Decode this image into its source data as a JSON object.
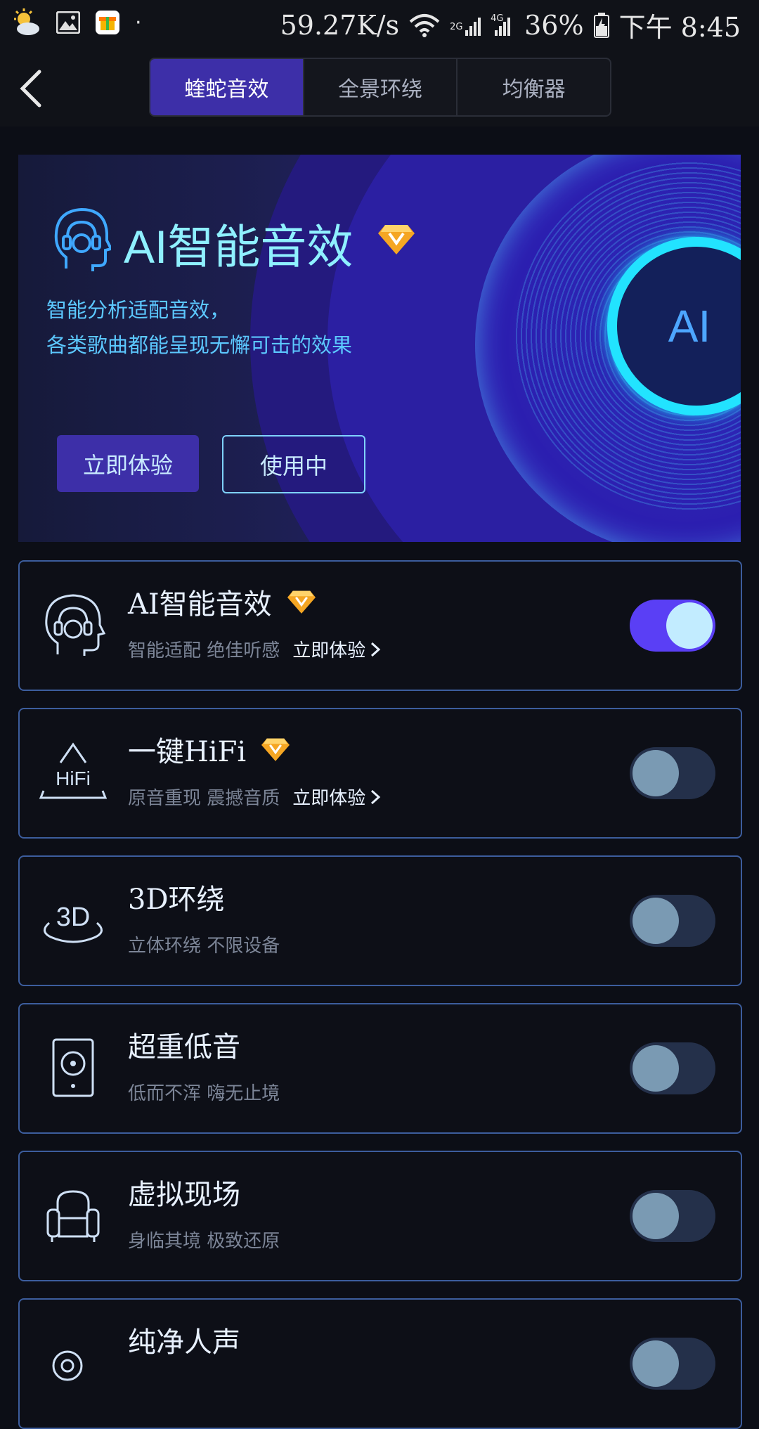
{
  "status_bar": {
    "net_speed": "59.27K/s",
    "net_type_2g": "2G",
    "net_type_4g": "4G",
    "battery": "36%",
    "time": "下午 8:45",
    "dot": "·"
  },
  "header": {
    "tabs": [
      {
        "label": "蝰蛇音效",
        "active": true
      },
      {
        "label": "全景环绕",
        "active": false
      },
      {
        "label": "均衡器",
        "active": false
      }
    ]
  },
  "banner": {
    "title": "AI智能音效",
    "desc_line1": "智能分析适配音效，",
    "desc_line2": "各类歌曲都能呈现无懈可击的效果",
    "try_button": "立即体验",
    "using_button": "使用中",
    "circle_text": "AI"
  },
  "effects": [
    {
      "title": "AI智能音效",
      "vip": true,
      "sub": "智能适配 绝佳听感",
      "link": "立即体验",
      "enabled": true,
      "icon": "head-icon"
    },
    {
      "title": "一键HiFi",
      "vip": true,
      "sub": "原音重现 震撼音质",
      "link": "立即体验",
      "enabled": false,
      "icon": "hifi-icon"
    },
    {
      "title": "3D环绕",
      "vip": false,
      "sub": "立体环绕 不限设备",
      "link": "",
      "enabled": false,
      "icon": "3d-icon"
    },
    {
      "title": "超重低音",
      "vip": false,
      "sub": "低而不浑 嗨无止境",
      "link": "",
      "enabled": false,
      "icon": "speaker-icon"
    },
    {
      "title": "虚拟现场",
      "vip": false,
      "sub": "身临其境 极致还原",
      "link": "",
      "enabled": false,
      "icon": "armchair-icon"
    },
    {
      "title": "纯净人声",
      "vip": false,
      "sub": "",
      "link": "",
      "enabled": false,
      "icon": "voice-icon"
    }
  ],
  "icon_labels": {
    "hifi": "HiFi",
    "three_d": "3D"
  },
  "colors": {
    "accent": "#3d2fa8",
    "toggle_on": "#5a3ff5",
    "card_border": "#3c5d9d",
    "vip_gem": "#f5a623"
  }
}
